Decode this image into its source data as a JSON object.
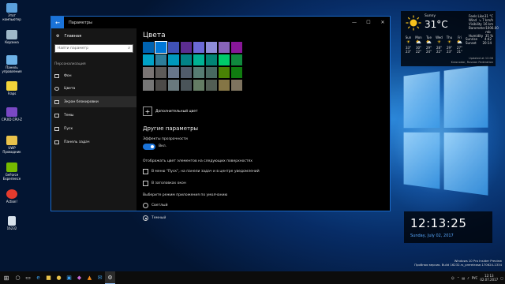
{
  "desktop": {
    "icons": [
      {
        "label": "Этот компьютер",
        "color": "#5ba0dc"
      },
      {
        "label": "Корзина",
        "color": "#9fb8c9"
      },
      {
        "label": "Панель управления",
        "color": "#6db2e8"
      },
      {
        "label": "Fraps",
        "color": "#f2d43a"
      },
      {
        "label": "CPUID CPU-Z",
        "color": "#7a48c4"
      },
      {
        "label": "UWP Проводник",
        "color": "#e9c24b"
      },
      {
        "label": "GeForce Experience",
        "color": "#76b900"
      },
      {
        "label": "Action!",
        "color": "#e33b2e"
      },
      {
        "label": "16232",
        "color": "#d8e2ec"
      }
    ]
  },
  "window": {
    "title": "Параметры",
    "controls": {
      "minimize": "—",
      "maximize": "☐",
      "close": "✕"
    }
  },
  "sidebar": {
    "home": "Главная",
    "search_placeholder": "Найти параметр",
    "section": "Персонализация",
    "items": [
      {
        "label": "Фон"
      },
      {
        "label": "Цвета"
      },
      {
        "label": "Экран блокировки"
      },
      {
        "label": "Темы"
      },
      {
        "label": "Пуск"
      },
      {
        "label": "Панель задач"
      }
    ]
  },
  "content": {
    "title": "Цвета",
    "swatches": [
      "#0063b1",
      "#0078d7",
      "#3f51b5",
      "#5c2d91",
      "#6b69d6",
      "#8e8cd8",
      "#8764b8",
      "#881798",
      "#00a2c7",
      "#2d7d9a",
      "#0099bc",
      "#038387",
      "#00b294",
      "#018574",
      "#00cc6a",
      "#10893e",
      "#7a7574",
      "#5d5a58",
      "#68768a",
      "#515c6b",
      "#567c73",
      "#486860",
      "#498205",
      "#107c10",
      "#767676",
      "#4c4a48",
      "#69797e",
      "#4a5459",
      "#647c64",
      "#525e54",
      "#847545",
      "#7e735f"
    ],
    "selected_swatch": 1,
    "add_color": "Дополнительный цвет",
    "other_title": "Другие параметры",
    "transparency_label": "Эффекты прозрачности",
    "transparency_state": "Вкл.",
    "surfaces_label": "Отображать цвет элементов на следующих поверхностях",
    "surface_start": "В меню \"Пуск\", на панели задач и в центре уведомлений",
    "surface_titlebars": "В заголовках окон",
    "mode_label": "Выберите режим приложения по умолчанию",
    "mode_light": "Светлый",
    "mode_dark": "Темный"
  },
  "weather": {
    "condition": "Sunny",
    "temp": "31°C",
    "details": [
      {
        "k": "Feels Like",
        "v": "31 °C"
      },
      {
        "k": "Wind",
        "v": "↘ 7 km/h"
      },
      {
        "k": "Visibility",
        "v": "16 km"
      },
      {
        "k": "Barometer",
        "v": "1006.00 mb"
      },
      {
        "k": "Humidity",
        "v": "35 %"
      }
    ],
    "days": [
      {
        "d": "Sun",
        "hi": "33°",
        "lo": "23°"
      },
      {
        "d": "Mon",
        "hi": "30°",
        "lo": "22°"
      },
      {
        "d": "Tue",
        "hi": "29°",
        "lo": "24°"
      },
      {
        "d": "Wed",
        "hi": "28°",
        "lo": "22°"
      },
      {
        "d": "Thu",
        "hi": "29°",
        "lo": "23°"
      },
      {
        "d": "Fri",
        "hi": "27°",
        "lo": "21°"
      }
    ],
    "sunrise_label": "Sunrise",
    "sunrise": "4:42",
    "sunset_label": "Sunset",
    "sunset": "20:14",
    "updated": "Updated at 12:06",
    "location": "Krasnodar, Russian Federation"
  },
  "clock": {
    "time": "12:13:25",
    "date": "Sunday, July 02, 2017"
  },
  "watermark": {
    "line1": "Windows 10 Pro Insider Preview",
    "line2": "Пробная версия. Build 16232.rs_prerelease.170624-1334"
  },
  "taskbar": {
    "lang": "РУС",
    "time": "12:13",
    "date": "02.07.2017"
  }
}
